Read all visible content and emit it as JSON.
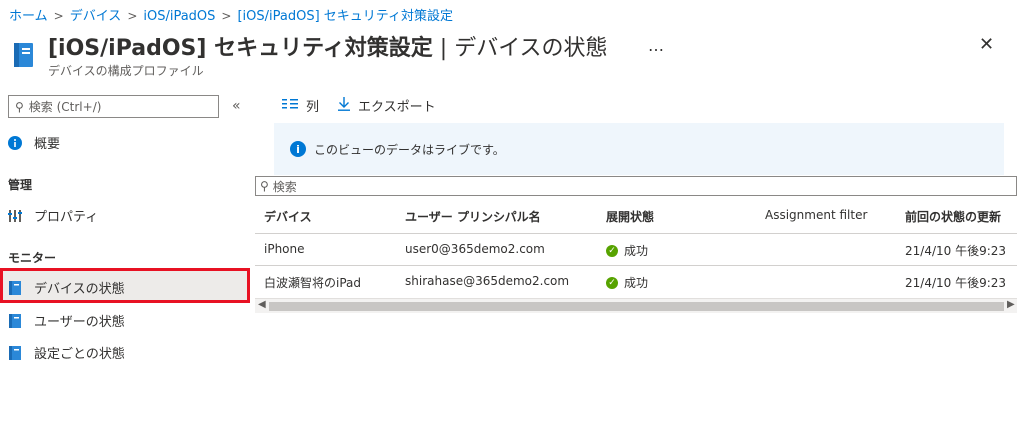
{
  "breadcrumb": [
    "ホーム",
    "デバイス",
    "iOS/iPadOS",
    "[iOS/iPadOS] セキュリティ対策設定"
  ],
  "header": {
    "title_main": "[iOS/iPadOS] セキュリティ対策設定",
    "title_sep": " | ",
    "title_sub": "デバイスの状態",
    "subtitle": "デバイスの構成プロファイル",
    "more": "…",
    "close": "✕"
  },
  "nav": {
    "search_placeholder": "検索 (Ctrl+/)",
    "collapse": "«",
    "overview": "概要",
    "section_manage": "管理",
    "properties": "プロパティ",
    "section_monitor": "モニター",
    "device_status": "デバイスの状態",
    "user_status": "ユーザーの状態",
    "per_setting_status": "設定ごとの状態"
  },
  "toolbar": {
    "columns_label": "列",
    "export_label": "エクスポート"
  },
  "info": {
    "icon": "i",
    "message": "このビューのデータはライブです。"
  },
  "grid": {
    "search_placeholder": "検索",
    "columns": [
      "デバイス",
      "ユーザー プリンシパル名",
      "展開状態",
      "Assignment filter",
      "前回の状態の更新"
    ],
    "rows": [
      {
        "device": "iPhone",
        "upn": "user0@365demo2.com",
        "status": "成功",
        "filter": "",
        "last_update": "21/4/10 午後9:23"
      },
      {
        "device": "白波瀬智将のiPad",
        "upn": "shirahase@365demo2.com",
        "status": "成功",
        "filter": "",
        "last_update": "21/4/10 午後9:23"
      }
    ]
  },
  "colors": {
    "accent": "#0078d4",
    "success": "#57a300",
    "highlight_border": "#e81123",
    "info_bg": "#eff6fc"
  }
}
